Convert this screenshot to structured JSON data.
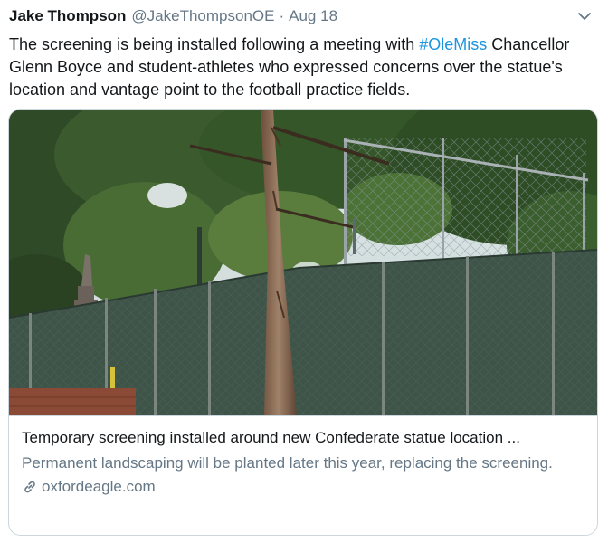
{
  "tweet": {
    "author_name": "Jake Thompson",
    "handle": "@JakeThompsonOE",
    "separator": "·",
    "date": "Aug 18",
    "text_before": "The screening is being installed following a meeting with ",
    "hashtag": "#OleMiss",
    "text_after": " Chancellor Glenn Boyce and student-athletes who expressed concerns over the statue's location and vantage point to the football practice fields."
  },
  "card": {
    "image_icon": "photo",
    "title": "Temporary screening installed around new Confederate statue location ...",
    "description": "Permanent landscaping will be planted later this year, replacing the screening.",
    "domain": "oxfordeagle.com",
    "link_icon": "link-icon"
  },
  "icons": {
    "menu": "chevron-down-icon"
  },
  "colors": {
    "text": "#14171a",
    "secondary": "#657786",
    "link": "#1b95e0",
    "border": "#ccd6dd"
  }
}
